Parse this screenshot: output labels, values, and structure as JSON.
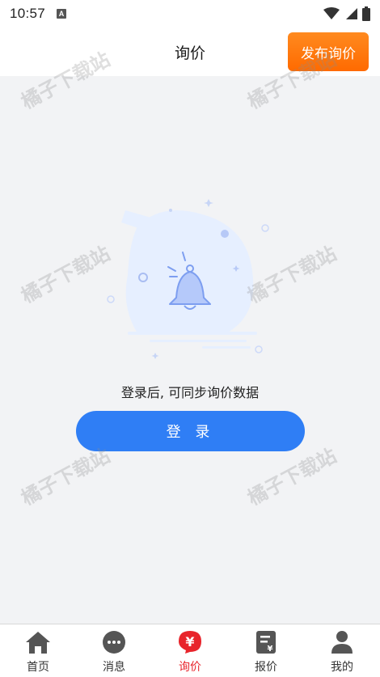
{
  "status_bar": {
    "time": "10:57",
    "notification_icon": "a-letter-icon",
    "icons": [
      "wifi-icon",
      "signal-icon",
      "battery-icon"
    ]
  },
  "header": {
    "title": "询价",
    "publish_button": "发布询价"
  },
  "empty_state": {
    "illustration": "bell-icon",
    "message": "登录后, 可同步询价数据",
    "login_button": "登 录"
  },
  "watermark": "橘子下载站",
  "tabs": [
    {
      "label": "首页",
      "icon": "home-icon",
      "active": false
    },
    {
      "label": "消息",
      "icon": "chat-icon",
      "active": false
    },
    {
      "label": "询价",
      "icon": "yen-icon",
      "active": true
    },
    {
      "label": "报价",
      "icon": "quote-doc-icon",
      "active": false
    },
    {
      "label": "我的",
      "icon": "user-icon",
      "active": false
    }
  ],
  "colors": {
    "accent_orange": "#ff7a10",
    "primary_blue": "#2f7ef5",
    "active_red": "#e8242b",
    "background": "#f2f3f5"
  }
}
